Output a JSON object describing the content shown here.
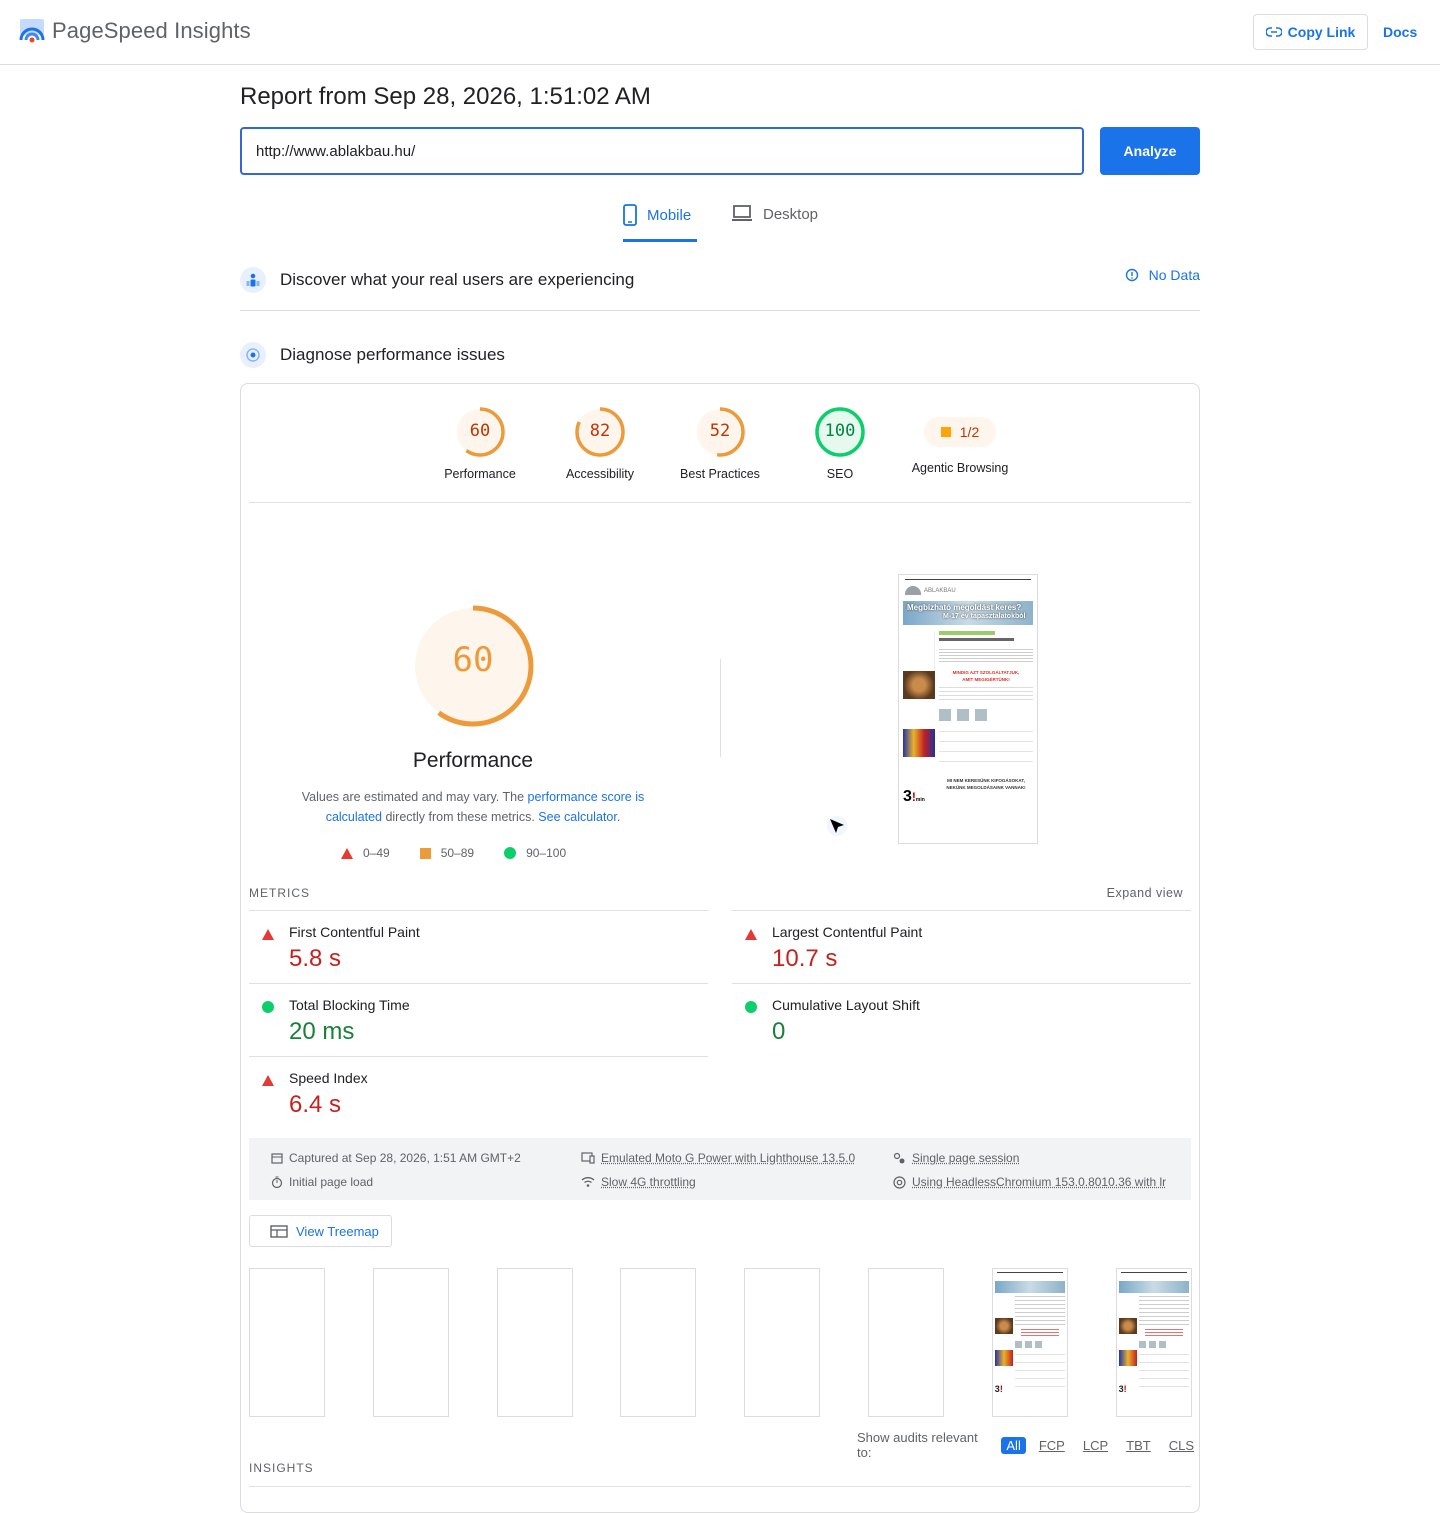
{
  "header": {
    "brand": "PageSpeed Insights",
    "copy_link": "Copy Link",
    "docs": "Docs"
  },
  "report": {
    "title": "Report from Sep 28, 2026, 1:51:02 AM",
    "url": "http://www.ablakbau.hu/",
    "analyze": "Analyze"
  },
  "tabs": [
    {
      "label": "Mobile",
      "active": true
    },
    {
      "label": "Desktop",
      "active": false
    }
  ],
  "field": {
    "title": "Discover what your real users are experiencing",
    "status": "No Data"
  },
  "lab": {
    "title": "Diagnose performance issues"
  },
  "categories": [
    {
      "label": "Performance",
      "score": "60",
      "fraction": 0.6,
      "color": "#ed9b3a",
      "text_color": "#c33300"
    },
    {
      "label": "Accessibility",
      "score": "82",
      "fraction": 0.82,
      "color": "#ed9b3a",
      "text_color": "#c33300"
    },
    {
      "label": "Best Practices",
      "score": "52",
      "fraction": 0.52,
      "color": "#ed9b3a",
      "text_color": "#c33300"
    },
    {
      "label": "SEO",
      "score": "100",
      "fraction": 1.0,
      "color": "#0cce6b",
      "text_color": "#018642"
    },
    {
      "label": "Agentic Browsing",
      "score": "1/2"
    }
  ],
  "performance": {
    "score": "60",
    "fraction": 0.6,
    "title": "Performance",
    "explain_prefix": "Values are estimated and may vary. The ",
    "explain_link": "performance score is calculated",
    "explain_mid": " directly from these metrics. ",
    "explain_calc": "See calculator",
    "explain_end": "."
  },
  "legend": [
    "0–49",
    "50–89",
    "90–100"
  ],
  "metrics_header": "METRICS",
  "expand_view": "Expand view",
  "metrics": [
    {
      "name": "First Contentful Paint",
      "value": "5.8 s",
      "status": "fail"
    },
    {
      "name": "Largest Contentful Paint",
      "value": "10.7 s",
      "status": "fail"
    },
    {
      "name": "Total Blocking Time",
      "value": "20 ms",
      "status": "pass"
    },
    {
      "name": "Cumulative Layout Shift",
      "value": "0",
      "status": "pass"
    },
    {
      "name": "Speed Index",
      "value": "6.4 s",
      "status": "fail"
    }
  ],
  "environment": {
    "captured": "Captured at Sep 28, 2026, 1:51 AM GMT+2",
    "load": "Initial page load",
    "device": "Emulated Moto G Power with Lighthouse 13.5.0",
    "throttling": "Slow 4G throttling",
    "session": "Single page session",
    "browser": "Using HeadlessChromium 153.0.8010.36 with lr"
  },
  "treemap": "View Treemap",
  "filmstrip": {
    "frames": 8,
    "filled": [
      7,
      8
    ]
  },
  "audit_filter": {
    "label": "Show audits relevant to:",
    "options": [
      "All",
      "FCP",
      "LCP",
      "TBT",
      "CLS"
    ],
    "selected": "All"
  },
  "insights_header": "INSIGHTS",
  "screenshot": {
    "headline": "Megbízható megoldást keres?",
    "subline": "M-17 év tapasztalatokból",
    "red_line1": "MINDIG AZT SZOLGÁLTATJUK,",
    "red_line2": "AMIT MEGIGÉRTÜNK!",
    "footer1": "MI NEM KERESÜNK KIFOGÁSOKAT,",
    "footer2": "NEKÜNK MEGOLDÁSAINK VANNAK!",
    "badge": "3",
    "badge_unit": "min"
  },
  "colors": {
    "accent": "#1a73e8",
    "average": "#ed9b3a",
    "pass": "#0cce6b",
    "fail": "#e53935"
  }
}
